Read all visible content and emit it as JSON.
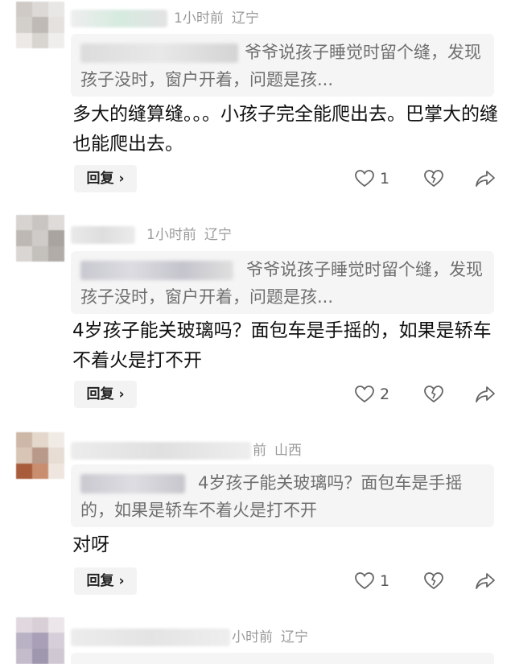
{
  "comments": [
    {
      "time": "1小时前",
      "location": "辽宁",
      "quote": "爷爷说孩子睡觉时留个缝，发现孩子没时，窗户开着，问题是孩...",
      "text": "多大的缝算缝。。。小孩子完全能爬出去。巴掌大的缝也能爬出去。",
      "reply_label": "回复 ›",
      "like_count": "1"
    },
    {
      "time": "1小时前",
      "location": "辽宁",
      "quote": "爷爷说孩子睡觉时留个缝，发现孩子没时，窗户开着，问题是孩...",
      "text": "4岁孩子能关玻璃吗？面包车是手摇的，如果是轿车不着火是打不开",
      "reply_label": "回复 ›",
      "like_count": "2"
    },
    {
      "time": "前",
      "location": "山西",
      "quote": "4岁孩子能关玻璃吗？面包车是手摇的，如果是轿车不着火是打不开",
      "text": "对呀",
      "reply_label": "回复 ›",
      "like_count": "1"
    },
    {
      "time": "小时前",
      "location": "辽宁"
    }
  ],
  "icons": [
    "like-heart-icon",
    "dislike-heart-icon",
    "share-icon"
  ],
  "colors": {
    "quote_bg": "#f5f5f5",
    "meta_text": "#9a9a9a",
    "icon": "#666666"
  }
}
